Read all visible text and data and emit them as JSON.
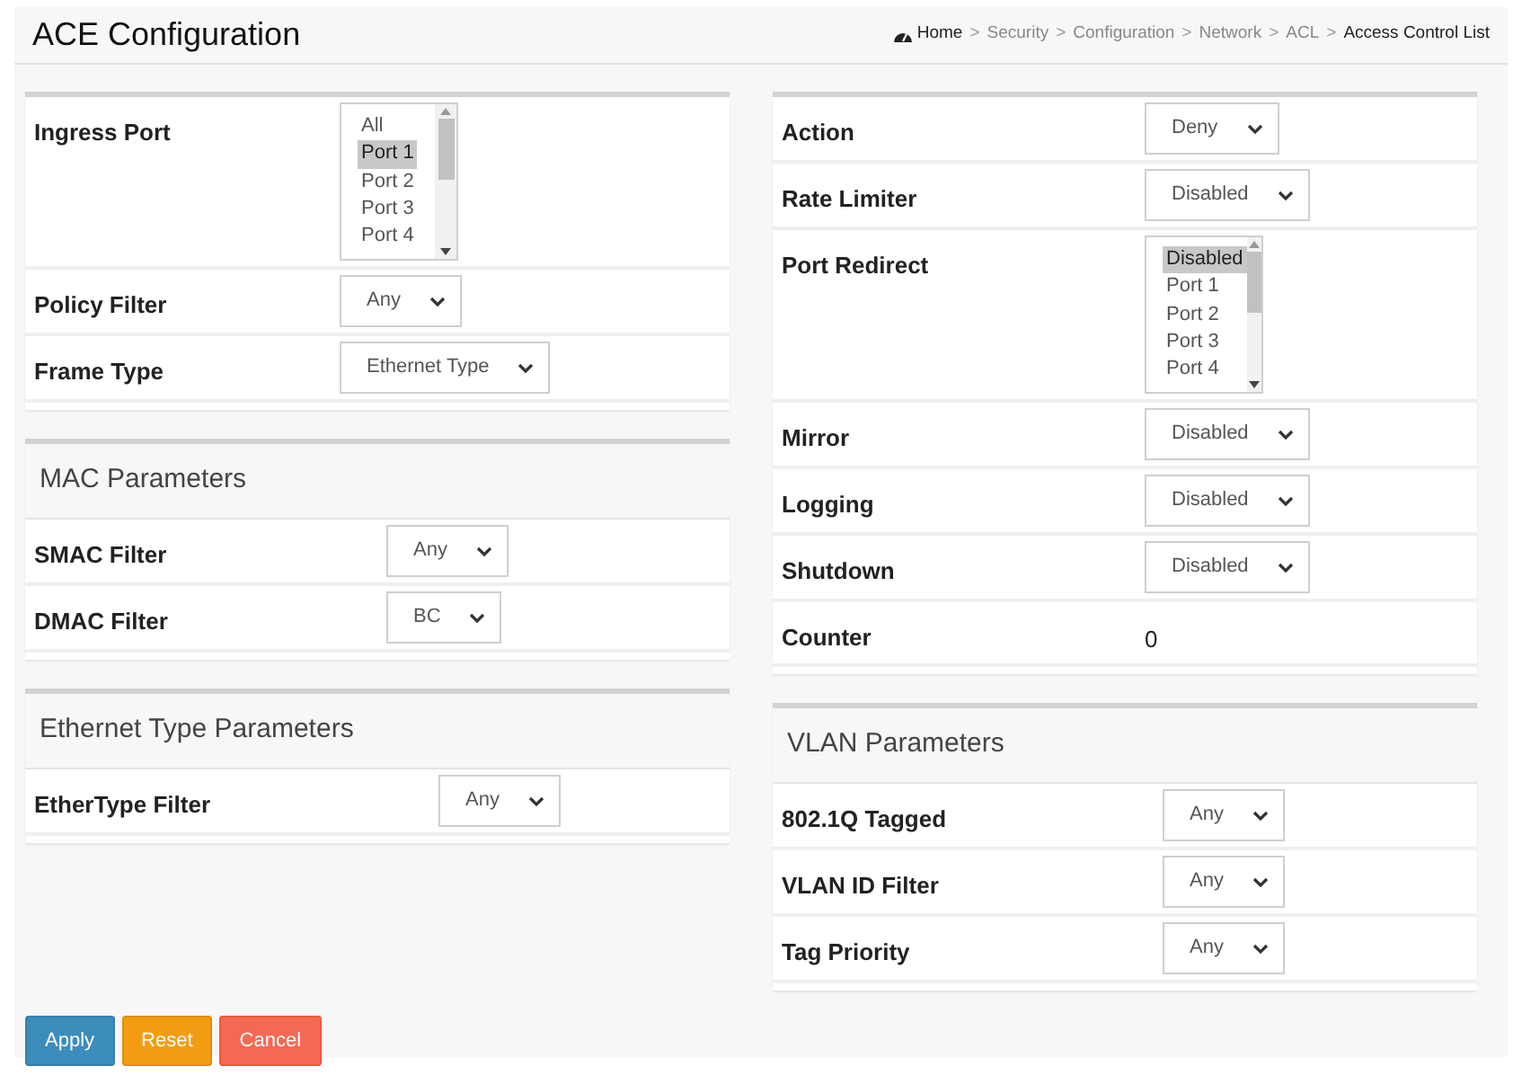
{
  "header": {
    "title": "ACE Configuration",
    "breadcrumb": [
      {
        "label": "Home",
        "kind": "home"
      },
      {
        "label": "Security",
        "kind": "link"
      },
      {
        "label": "Configuration",
        "kind": "link"
      },
      {
        "label": "Network",
        "kind": "link"
      },
      {
        "label": "ACL",
        "kind": "link"
      },
      {
        "label": "Access Control List",
        "kind": "current"
      }
    ],
    "separator": ">"
  },
  "left_panels": [
    {
      "rows": [
        {
          "label": "Ingress Port",
          "kind": "listbox",
          "options": [
            {
              "label": "All",
              "selected": false
            },
            {
              "label": "Port 1",
              "selected": true
            },
            {
              "label": "Port 2",
              "selected": false
            },
            {
              "label": "Port 3",
              "selected": false
            },
            {
              "label": "Port 4",
              "selected": false
            }
          ]
        },
        {
          "label": "Policy Filter",
          "kind": "select",
          "value": "Any"
        },
        {
          "label": "Frame Type",
          "kind": "select",
          "value": "Ethernet Type"
        }
      ]
    },
    {
      "title": "MAC Parameters",
      "rows": [
        {
          "label": "SMAC Filter",
          "kind": "select",
          "value": "Any"
        },
        {
          "label": "DMAC Filter",
          "kind": "select",
          "value": "BC"
        }
      ]
    },
    {
      "title": "Ethernet Type Parameters",
      "rows": [
        {
          "label": "EtherType Filter",
          "kind": "select",
          "value": "Any"
        }
      ]
    }
  ],
  "right_panels": [
    {
      "rows": [
        {
          "label": "Action",
          "kind": "select",
          "value": "Deny"
        },
        {
          "label": "Rate Limiter",
          "kind": "select",
          "value": "Disabled"
        },
        {
          "label": "Port Redirect",
          "kind": "listbox",
          "options": [
            {
              "label": "Disabled",
              "selected": true
            },
            {
              "label": "Port 1",
              "selected": false
            },
            {
              "label": "Port 2",
              "selected": false
            },
            {
              "label": "Port 3",
              "selected": false
            },
            {
              "label": "Port 4",
              "selected": false
            }
          ]
        },
        {
          "label": "Mirror",
          "kind": "select",
          "value": "Disabled"
        },
        {
          "label": "Logging",
          "kind": "select",
          "value": "Disabled"
        },
        {
          "label": "Shutdown",
          "kind": "select",
          "value": "Disabled"
        },
        {
          "label": "Counter",
          "kind": "text",
          "value": "0"
        }
      ]
    },
    {
      "title": "VLAN Parameters",
      "rows": [
        {
          "label": "802.1Q Tagged",
          "kind": "select",
          "value": "Any"
        },
        {
          "label": "VLAN ID Filter",
          "kind": "select",
          "value": "Any"
        },
        {
          "label": "Tag Priority",
          "kind": "select",
          "value": "Any"
        }
      ]
    }
  ],
  "buttons": [
    {
      "label": "Apply",
      "kind": "primary"
    },
    {
      "label": "Reset",
      "kind": "warning"
    },
    {
      "label": "Cancel",
      "kind": "danger"
    }
  ]
}
